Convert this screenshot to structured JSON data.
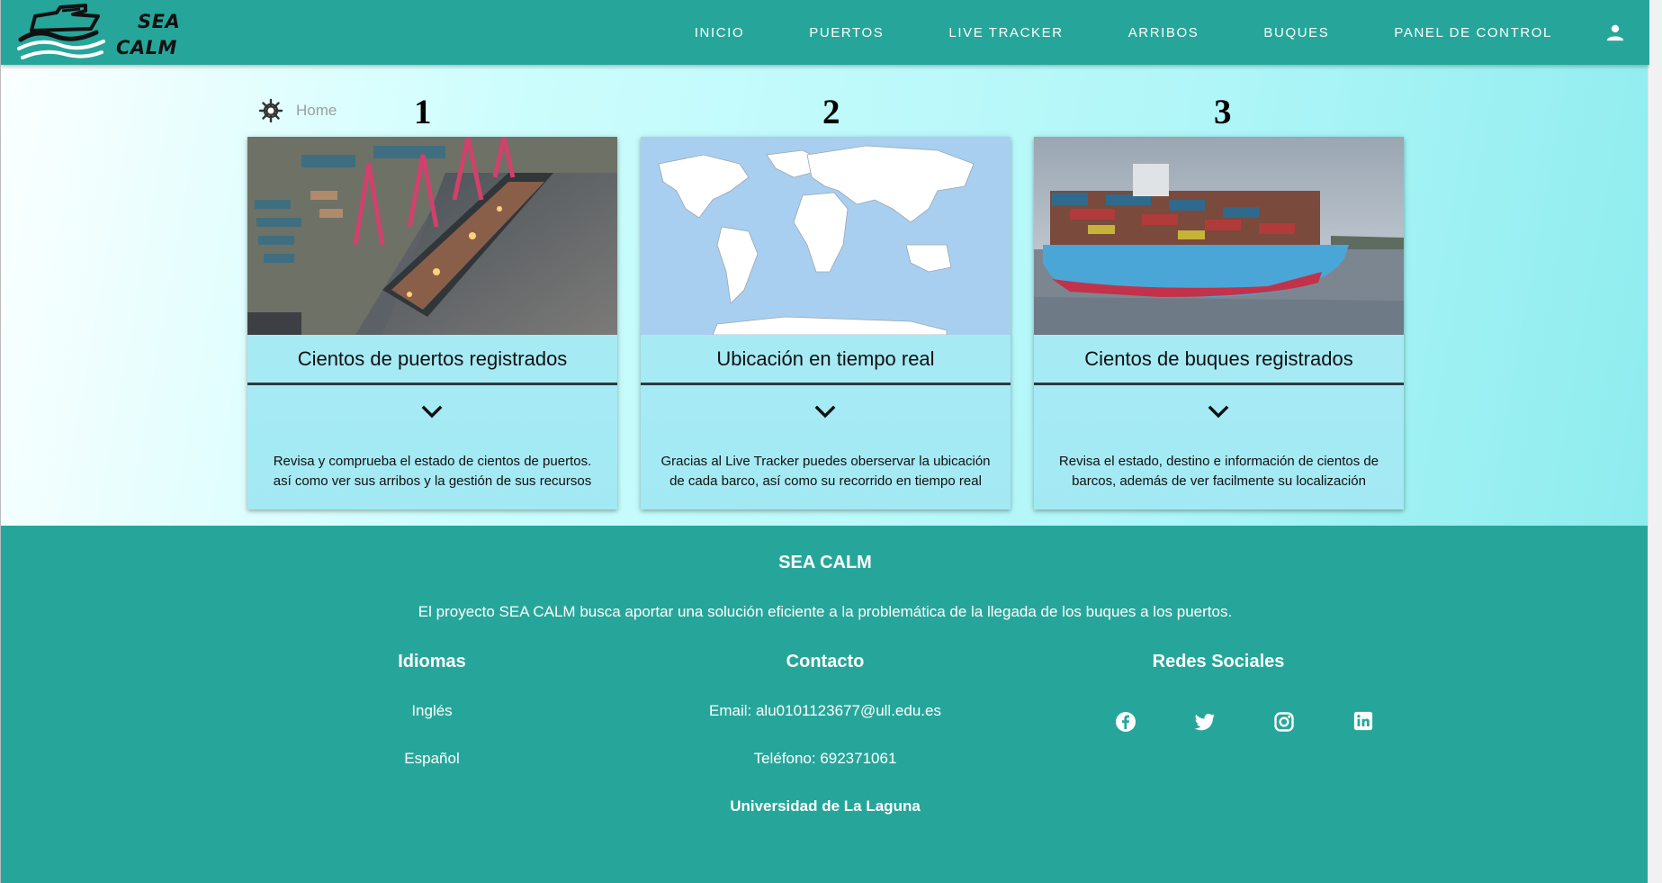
{
  "brand": {
    "line1": "SEA",
    "line2": "CALM"
  },
  "nav": {
    "items": [
      "INICIO",
      "PUERTOS",
      "LIVE TRACKER",
      "ARRIBOS",
      "BUQUES",
      "PANEL DE CONTROL"
    ],
    "user_icon": "person-icon"
  },
  "breadcrumb": {
    "icon": "ship-wheel-icon",
    "label": "Home"
  },
  "cards": [
    {
      "number": "1",
      "title": "Cientos de puertos registrados",
      "image": "port-cranes-image",
      "description": "Revisa y comprueba el estado de cientos de puertos. así como ver sus arribos y la gestión de sus recursos"
    },
    {
      "number": "2",
      "title": "Ubicación en tiempo real",
      "image": "world-map-image",
      "description": "Gracias al Live Tracker puedes oberservar la ubicación de cada barco, así como su recorrido en tiempo real"
    },
    {
      "number": "3",
      "title": "Cientos de buques registrados",
      "image": "container-ship-image",
      "description": "Revisa el estado, destino e información de cientos de barcos, además de ver facilmente su localización"
    }
  ],
  "footer": {
    "title": "SEA CALM",
    "description": "El proyecto SEA CALM busca aportar una solución eficiente a la problemática de la llegada de los buques a los puertos.",
    "languages": {
      "heading": "Idiomas",
      "items": [
        "Inglés",
        "Español"
      ]
    },
    "contact": {
      "heading": "Contacto",
      "email": "Email: alu0101123677@ull.edu.es",
      "phone": "Teléfono: 692371061"
    },
    "social": {
      "heading": "Redes Sociales",
      "icons": [
        "facebook-icon",
        "twitter-icon",
        "instagram-icon",
        "linkedin-icon"
      ]
    },
    "university": "Universidad de La Laguna"
  },
  "colors": {
    "primary": "#26a69a",
    "card_bg": "#a6ebf5",
    "text_dark": "#111111"
  }
}
